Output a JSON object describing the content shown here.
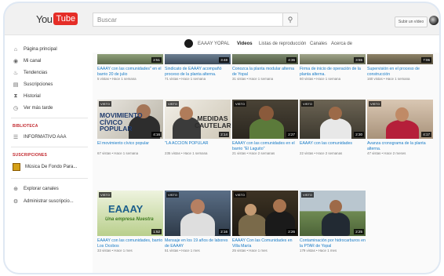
{
  "logo": {
    "you": "You",
    "tube": "Tube"
  },
  "search": {
    "placeholder": "Buscar"
  },
  "header": {
    "upload_label": "Subir un vídeo"
  },
  "sidebar": {
    "items": [
      {
        "icon": "home-icon",
        "glyph": "⌂",
        "label": "Página principal"
      },
      {
        "icon": "my-channel-icon",
        "glyph": "◉",
        "label": "Mi canal"
      },
      {
        "icon": "trending-icon",
        "glyph": "♨",
        "label": "Tendencias"
      },
      {
        "icon": "subscriptions-icon",
        "glyph": "▤",
        "label": "Suscripciones"
      },
      {
        "icon": "history-icon",
        "glyph": "⧗",
        "label": "Historial"
      },
      {
        "icon": "watch-later-icon",
        "glyph": "◷",
        "label": "Ver más tarde"
      }
    ],
    "library_heading": "BIBLIOTECA",
    "library_items": [
      {
        "icon": "playlist-icon",
        "glyph": "☰",
        "label": "INFORMATIVO AAA"
      }
    ],
    "subscriptions_heading": "SUSCRIPCIONES",
    "subscriptions": [
      {
        "label": "Música De Fondo Para..."
      }
    ],
    "footer_items": [
      {
        "icon": "browse-channels-icon",
        "glyph": "⊕",
        "label": "Explorar canales"
      },
      {
        "icon": "settings-icon",
        "glyph": "⚙",
        "label": "Administrar suscripcio..."
      }
    ]
  },
  "channel": {
    "name": "EAAAY YOPAL",
    "tabs": [
      "Videos",
      "Listas de reproducción",
      "Canales",
      "Acerca de"
    ],
    "active_tab": "Videos"
  },
  "videos_row1": [
    {
      "duration": "2:51",
      "title": "EAAAY con las comunidades\" en el barrio 20 de julio",
      "meta": "5 vistas • Hace 1 semana"
    },
    {
      "duration": "3:48",
      "title": "Sindicato de EAAAY acompañó proceso de la planta alterna.",
      "meta": "71 vistas • Hace 1 semana"
    },
    {
      "duration": "4:36",
      "title": "Conozca la planta modular alterna de Yopal",
      "meta": "31 vistas • Hace 1 semana"
    },
    {
      "duration": "3:55",
      "title": "Firma de inicio de operación de la planta alterna.",
      "meta": "60 vistas • Hace 1 semana"
    },
    {
      "duration": "7:06",
      "title": "Supervisión en el proceso de construcción",
      "meta": "160 vistas • Hace 1 semana"
    }
  ],
  "videos_row2": [
    {
      "badge": "VISTO",
      "duration": "4:16",
      "thumb_text": "MOVIMIENTO CÍVICO POPULAR",
      "title": "El movimiento cívico popular",
      "meta": "67 vistas • Hace 1 semana"
    },
    {
      "badge": "VISTO",
      "duration": "2:14",
      "thumb_text": "MEDIDAS CAUTELARES",
      "title": "\"LA ACCIÓN POPULAR",
      "meta": "235 vistas • Hace 1 semana"
    },
    {
      "badge": "VISTO",
      "duration": "2:27",
      "thumb_text": "",
      "title": "EAAAY con las comunidades en el barrio \"El Laguito\"",
      "meta": "21 vistas • Hace 2 semanas"
    },
    {
      "badge": "VISTO",
      "duration": "2:30",
      "thumb_text": "",
      "title": "EAAAY con las comunidades",
      "meta": "22 vistas • Hace 2 semanas"
    },
    {
      "badge": "VISTO",
      "duration": "4:17",
      "thumb_text": "",
      "title": "Avanza cronograma de la planta alterna.",
      "meta": "47 vistas • Hace 2 meses"
    }
  ],
  "videos_row3": [
    {
      "badge": "VISTO",
      "duration": "1:52",
      "thumb_text": "EAAAY",
      "thumb_sub": "Una empresa Nuestra",
      "title": "EAAAY con las comunidades, barrio Los Ocobos",
      "meta": "33 vistas • Hace 1 mes"
    },
    {
      "badge": "VISTO",
      "duration": "2:16",
      "thumb_text": "",
      "title": "Mensaje en los 19 años de labores de EAAAY",
      "meta": "51 vistas • Hace 1 mes"
    },
    {
      "badge": "VISTO",
      "duration": "2:26",
      "thumb_text": "",
      "title": "EAAAY Con las Comunidades en Villa María",
      "meta": "25 vistas • Hace 1 mes"
    },
    {
      "badge": "VISTO",
      "duration": "2:25",
      "thumb_text": "",
      "title": "Contaminación por hidrocarburos en la PTAR de Yopal",
      "meta": "179 vistas • Hace 1 mes"
    }
  ]
}
